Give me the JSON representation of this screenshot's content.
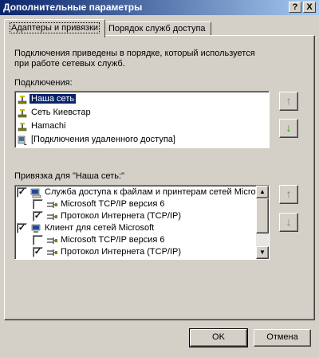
{
  "window": {
    "title": "Дополнительные параметры",
    "help_label": "?",
    "close_label": "X"
  },
  "tabs": [
    {
      "label": "Адаптеры и привязки",
      "active": true
    },
    {
      "label": "Порядок служб доступа",
      "active": false
    }
  ],
  "description": {
    "line1": "Подключения приведены в порядке, который используется",
    "line2": "при работе сетевых служб."
  },
  "connections": {
    "label": "Подключения:",
    "items": [
      {
        "label": "Наша сеть",
        "icon": "network-adapter-icon",
        "selected": true
      },
      {
        "label": "Сеть Киевстар",
        "icon": "network-adapter-icon",
        "selected": false
      },
      {
        "label": "Hamachi",
        "icon": "network-adapter-icon",
        "selected": false
      },
      {
        "label": "[Подключения удаленного доступа]",
        "icon": "dialup-connection-icon",
        "selected": false
      }
    ],
    "up_glyph": "↑",
    "down_glyph": "↓"
  },
  "bindings": {
    "label": "Привязка для \"Наша сеть:\"",
    "items": [
      {
        "label": "Служба доступа к файлам и принтерам сетей Microsoft",
        "level": 0,
        "checked": true,
        "icon": "file-printer-sharing-icon"
      },
      {
        "label": "Microsoft TCP/IP версия 6",
        "level": 1,
        "checked": false,
        "icon": "protocol-icon"
      },
      {
        "label": "Протокол Интернета (TCP/IP)",
        "level": 1,
        "checked": true,
        "icon": "protocol-icon"
      },
      {
        "label": "Клиент для сетей Microsoft",
        "level": 0,
        "checked": true,
        "icon": "network-client-icon"
      },
      {
        "label": "Microsoft TCP/IP версия 6",
        "level": 1,
        "checked": false,
        "icon": "protocol-icon"
      },
      {
        "label": "Протокол Интернета (TCP/IP)",
        "level": 1,
        "checked": true,
        "icon": "protocol-icon"
      }
    ],
    "up_glyph": "↑",
    "down_glyph": "↓"
  },
  "buttons": {
    "ok": "OK",
    "cancel": "Отмена"
  },
  "colors": {
    "selection": "#0a246a",
    "arrow_enabled": "#1a9a1a",
    "arrow_disabled": "#808080"
  }
}
